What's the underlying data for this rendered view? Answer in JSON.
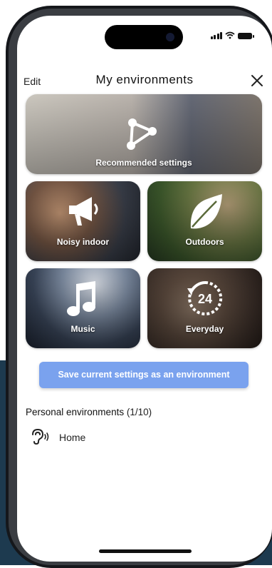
{
  "header": {
    "edit_label": "Edit",
    "title": "My environments",
    "close_icon": "close-icon"
  },
  "tiles": [
    {
      "label": "Recommended settings",
      "icon": "connected-nodes-icon"
    },
    {
      "label": "Noisy indoor",
      "icon": "megaphone-icon"
    },
    {
      "label": "Outdoors",
      "icon": "leaf-icon"
    },
    {
      "label": "Music",
      "icon": "music-note-icon"
    },
    {
      "label": "Everyday",
      "icon": "clock-24-icon",
      "icon_text": "24"
    }
  ],
  "save_button_label": "Save current settings as an environment",
  "personal": {
    "heading": "Personal environments",
    "count": "(1/10)",
    "items": [
      {
        "name": "Home",
        "icon": "ear-icon"
      }
    ]
  },
  "colors": {
    "accent_button": "#7aa2ee",
    "background_band": "#1d3a4f"
  }
}
